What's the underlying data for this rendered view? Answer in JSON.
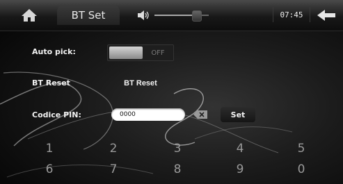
{
  "header": {
    "title": "BT Set",
    "clock": "07:45",
    "volume_level": 0.78
  },
  "settings": {
    "auto_pick_label": "Auto pick:",
    "auto_pick_state": "OFF",
    "bt_reset_label": "BT Reset",
    "bt_reset_button": "BT Reset",
    "pin_label": "Codice PIN:",
    "pin_value": "0000",
    "set_button": "Set"
  },
  "keypad": {
    "keys": [
      "1",
      "2",
      "3",
      "4",
      "5",
      "6",
      "7",
      "8",
      "9",
      "0"
    ]
  },
  "icons": {
    "home": "home-icon",
    "volume": "speaker-icon",
    "backspace": "backspace-icon",
    "back": "back-arrow-icon"
  }
}
